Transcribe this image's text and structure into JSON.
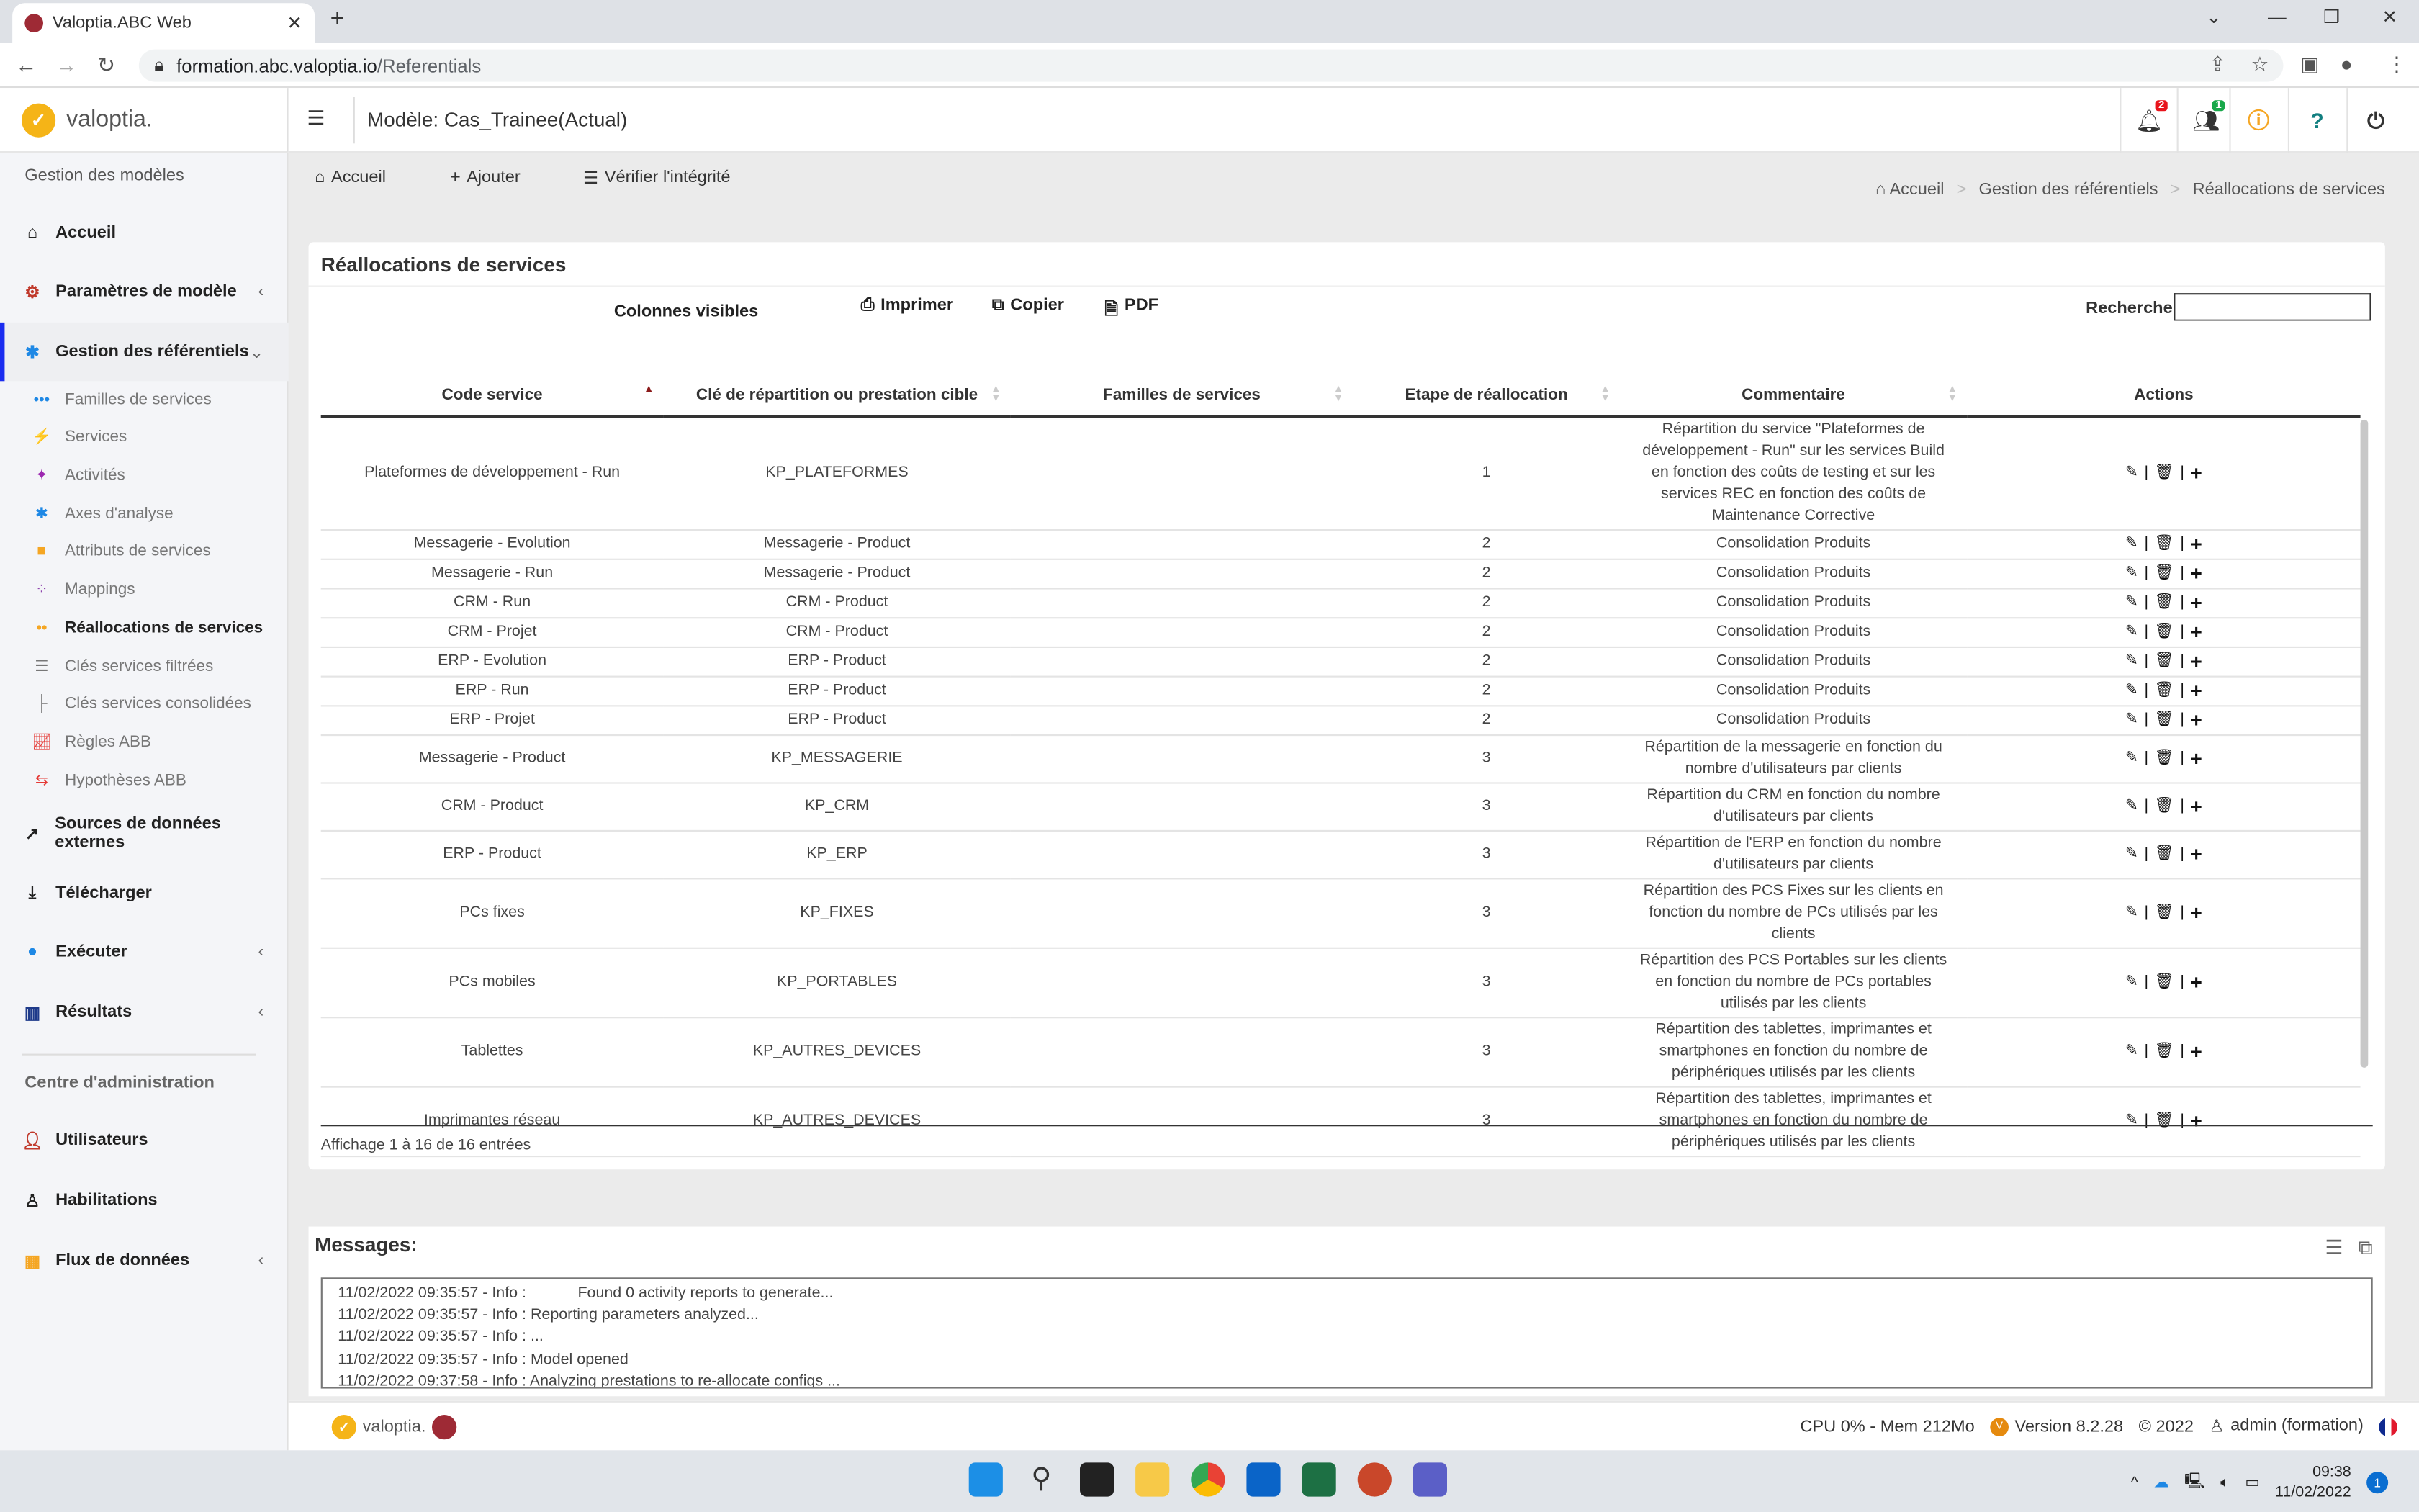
{
  "browser": {
    "tab_title": "Valoptia.ABC Web",
    "url_host": "formation.abc.valoptia.io",
    "url_path": "/Referentials"
  },
  "header": {
    "logo_text": "valoptia.",
    "model_title": "Modèle: Cas_Trainee(Actual)",
    "notifications_count": "2",
    "users_count": "1"
  },
  "colors": {
    "accent": "#1a2cf0",
    "logo": "#f5b417",
    "notif_badge": "#e8141c",
    "users_badge": "#18a84a",
    "info": "#f5a623",
    "help": "#127f80"
  },
  "sidebar": {
    "section1": "Gestion des modèles",
    "items": [
      {
        "label": "Accueil",
        "icon": "home-icon"
      },
      {
        "label": "Paramètres de modèle",
        "icon": "gear-icon"
      },
      {
        "label": "Gestion des référentiels",
        "icon": "network-icon"
      }
    ],
    "subitems": [
      "Familles de services",
      "Services",
      "Activités",
      "Axes d'analyse",
      "Attributs de services",
      "Mappings",
      "Réallocations de services",
      "Clés services filtrées",
      "Clés services consolidées",
      "Règles ABB",
      "Hypothèses ABB"
    ],
    "items2": [
      {
        "label": "Sources de données externes",
        "icon": "external-link-icon"
      },
      {
        "label": "Télécharger",
        "icon": "download-icon"
      },
      {
        "label": "Exécuter",
        "icon": "run-icon"
      },
      {
        "label": "Résultats",
        "icon": "results-icon"
      }
    ],
    "section2": "Centre d'administration",
    "items3": [
      {
        "label": "Utilisateurs",
        "icon": "user-icon"
      },
      {
        "label": "Habilitations",
        "icon": "permission-icon"
      },
      {
        "label": "Flux de données",
        "icon": "dataflow-icon"
      }
    ]
  },
  "toolbar": {
    "home": "Accueil",
    "add": "Ajouter",
    "check": "Vérifier l'intégrité"
  },
  "breadcrumb": [
    "Accueil",
    "Gestion des référentiels",
    "Réallocations de services"
  ],
  "card": {
    "title": "Réallocations de services",
    "visible_columns": "Colonnes visibles",
    "print": "Imprimer",
    "copy": "Copier",
    "pdf": "PDF",
    "search_label": "Recherche",
    "search_value": ""
  },
  "table": {
    "columns": [
      "Code service",
      "Clé de répartition ou prestation cible",
      "Familles de services",
      "Etape de réallocation",
      "Commentaire",
      "Actions"
    ],
    "sort": {
      "column": "Code service",
      "direction": "asc"
    },
    "rows": [
      [
        "Plateformes de développement - Run",
        "KP_PLATEFORMES",
        "",
        "1",
        "Répartition du service \"Plateformes de développement - Run\" sur les services Build en fonction des coûts de testing et sur les services REC en fonction des coûts de Maintenance Corrective"
      ],
      [
        "Messagerie - Evolution",
        "Messagerie - Product",
        "",
        "2",
        "Consolidation Produits"
      ],
      [
        "Messagerie - Run",
        "Messagerie - Product",
        "",
        "2",
        "Consolidation Produits"
      ],
      [
        "CRM - Run",
        "CRM - Product",
        "",
        "2",
        "Consolidation Produits"
      ],
      [
        "CRM - Projet",
        "CRM - Product",
        "",
        "2",
        "Consolidation Produits"
      ],
      [
        "ERP - Evolution",
        "ERP - Product",
        "",
        "2",
        "Consolidation Produits"
      ],
      [
        "ERP - Run",
        "ERP - Product",
        "",
        "2",
        "Consolidation Produits"
      ],
      [
        "ERP - Projet",
        "ERP - Product",
        "",
        "2",
        "Consolidation Produits"
      ],
      [
        "Messagerie - Product",
        "KP_MESSAGERIE",
        "",
        "3",
        "Répartition de la messagerie en fonction du nombre d'utilisateurs par clients"
      ],
      [
        "CRM - Product",
        "KP_CRM",
        "",
        "3",
        "Répartition du CRM en fonction du nombre d'utilisateurs par clients"
      ],
      [
        "ERP - Product",
        "KP_ERP",
        "",
        "3",
        "Répartition de l'ERP en fonction du nombre d'utilisateurs par clients"
      ],
      [
        "PCs fixes",
        "KP_FIXES",
        "",
        "3",
        "Répartition des PCS Fixes sur les clients en fonction du nombre de PCs utilisés par les clients"
      ],
      [
        "PCs mobiles",
        "KP_PORTABLES",
        "",
        "3",
        "Répartition des PCS Portables sur les clients en fonction du nombre de PCs portables utilisés par les clients"
      ],
      [
        "Tablettes",
        "KP_AUTRES_DEVICES",
        "",
        "3",
        "Répartition des tablettes, imprimantes et smartphones en fonction du nombre de périphériques utilisés par les clients"
      ],
      [
        "Imprimantes réseau",
        "KP_AUTRES_DEVICES",
        "",
        "3",
        "Répartition des tablettes, imprimantes et smartphones en fonction du nombre de périphériques utilisés par les clients"
      ]
    ],
    "info": "Affichage 1 à 16 de 16 entrées"
  },
  "messages": {
    "title": "Messages:",
    "lines": [
      "11/02/2022 09:35:57 - Info :            Found 0 activity reports to generate...",
      "11/02/2022 09:35:57 - Info : Reporting parameters analyzed...",
      "11/02/2022 09:35:57 - Info : ...",
      "11/02/2022 09:35:57 - Info : Model opened",
      "11/02/2022 09:37:58 - Info : Analyzing prestations to re-allocate configs ..."
    ]
  },
  "footer": {
    "logo_text": "valoptia.",
    "cpu": "CPU 0% - Mem 212Mo",
    "version": "Version 8.2.28",
    "copyright": "© 2022",
    "user": "admin (formation)"
  },
  "taskbar": {
    "time": "09:38",
    "date": "11/02/2022",
    "notifications": "1"
  }
}
